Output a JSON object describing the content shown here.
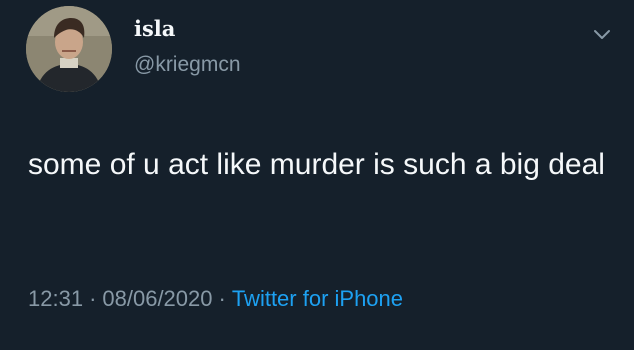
{
  "user": {
    "display_name": "isla",
    "handle": "@kriegmcn",
    "avatar_icon": "profile-photo"
  },
  "tweet": {
    "text": "some of u act like murder is such a big deal"
  },
  "meta": {
    "time": "12:31",
    "date": "08/06/2020",
    "separator": "·",
    "source": "Twitter for iPhone"
  },
  "menu": {
    "icon": "chevron-down-icon"
  },
  "colors": {
    "background": "#15202b",
    "text": "#f5f8fa",
    "secondary": "#8899a6",
    "link": "#1da1f2"
  }
}
